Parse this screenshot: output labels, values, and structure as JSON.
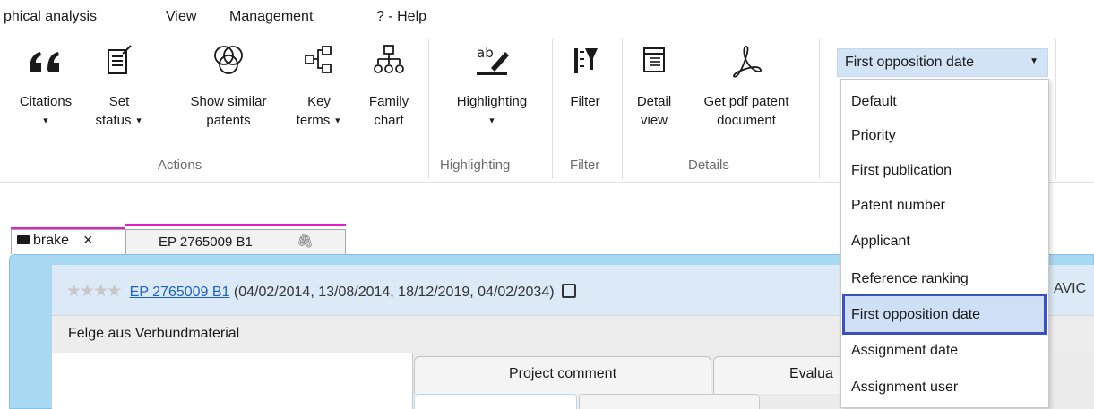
{
  "menubar": {
    "items": [
      "phical analysis",
      "View",
      "Management",
      "? - Help"
    ]
  },
  "ribbon": {
    "buttons": [
      {
        "label_1": "Citations",
        "label_2": "",
        "icon": "quote-icon"
      },
      {
        "label_1": "Set",
        "label_2": "status",
        "icon": "edit-document-icon"
      },
      {
        "label_1": "Show similar",
        "label_2": "patents",
        "icon": "venn-icon"
      },
      {
        "label_1": "Key",
        "label_2": "terms",
        "icon": "flow-icon"
      },
      {
        "label_1": "Family",
        "label_2": "chart",
        "icon": "hierarchy-icon"
      },
      {
        "label_1": "Highlighting",
        "label_2": "",
        "icon": "highlighter-icon"
      },
      {
        "label_1": "Filter",
        "label_2": "",
        "icon": "filter-icon"
      },
      {
        "label_1": "Detail",
        "label_2": "view",
        "icon": "detail-view-icon"
      },
      {
        "label_1": "Get pdf patent",
        "label_2": "document",
        "icon": "pdf-icon"
      }
    ],
    "groups": [
      "Actions",
      "Highlighting",
      "Filter",
      "Details"
    ]
  },
  "sort_dropdown": {
    "selected": "First opposition date",
    "options": [
      "Default",
      "Priority",
      "First publication",
      "Patent number",
      "Applicant",
      "Reference ranking",
      "First opposition date",
      "Assignment date",
      "Assignment user"
    ]
  },
  "doc_tabs": [
    {
      "label": "brake",
      "close": "×"
    },
    {
      "label": "EP 2765009 B1"
    }
  ],
  "patent": {
    "number": "EP 2765009 B1",
    "dates": "(04/02/2014, 13/08/2014, 18/12/2019, 04/02/2034)",
    "right_text": "AVIC",
    "title": "Felge aus Verbundmaterial"
  },
  "subtabs": [
    "Project comment",
    "Evalua"
  ],
  "colors": {
    "accent_blue": "#1b62c6",
    "selection_border": "#3a50c0",
    "tab_highlight": "#e020c8",
    "frame_blue": "#a9d8f3"
  }
}
